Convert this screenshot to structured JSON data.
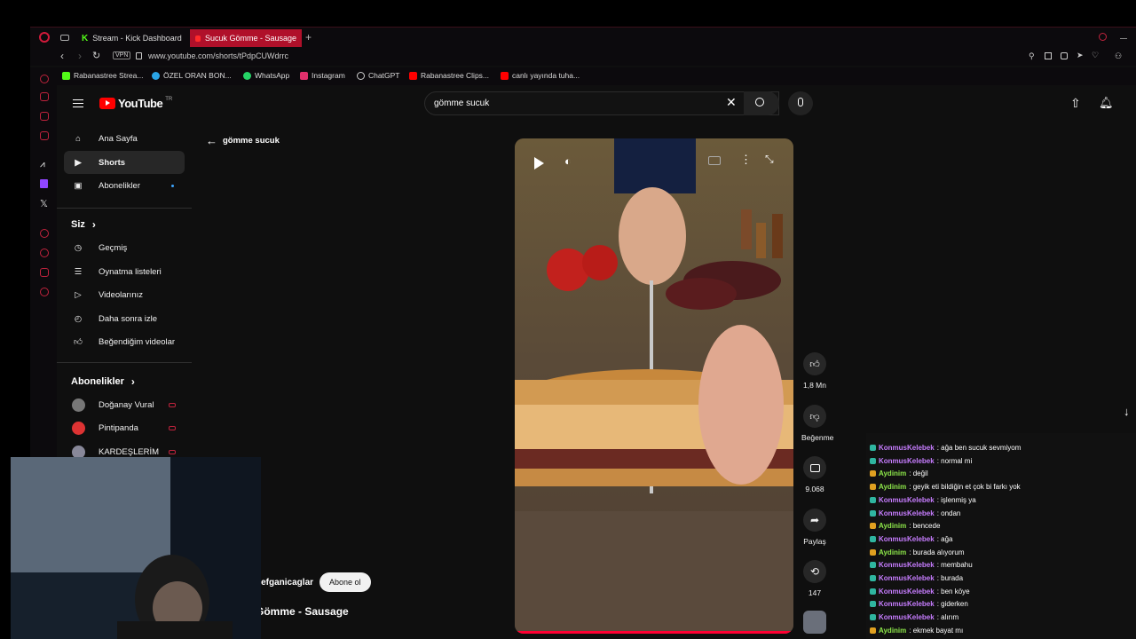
{
  "browser": {
    "tabs": [
      {
        "label": "Stream - Kick Dashboard",
        "active": false
      },
      {
        "label": "Sucuk Gömme - Sausage",
        "active": true
      }
    ],
    "url": "www.youtube.com/shorts/tPdpCUWdrrc",
    "vpn_label": "VPN",
    "bookmarks": [
      "Rabanastree Strea...",
      "ÖZEL ORAN BON...",
      "WhatsApp",
      "Instagram",
      "ChatGPT",
      "Rabanastree Clips...",
      "canlı yayında tuha..."
    ]
  },
  "youtube": {
    "logo": "YouTube",
    "region": "TR",
    "search_value": "gömme sucuk",
    "back_label": "gömme sucuk",
    "nav": {
      "home": "Ana Sayfa",
      "shorts": "Shorts",
      "subscriptions": "Abonelikler",
      "you_section": "Siz",
      "history": "Geçmiş",
      "playlists": "Oynatma listeleri",
      "your_videos": "Videolarınız",
      "watch_later": "Daha sonra izle",
      "liked": "Beğendiğim videolar",
      "subs_section": "Abonelikler",
      "channels": [
        "Doğanay Vural",
        "Pintipanda",
        "KARDEŞLERİM"
      ]
    },
    "short": {
      "channel": "hefganicaglar",
      "subscribe": "Abone ol",
      "title": "Gömme - Sausage",
      "likes": "1,8 Mn",
      "dislike": "Beğenme",
      "comments": "9.068",
      "share": "Paylaş",
      "remix": "147"
    }
  },
  "chat": [
    {
      "user": "KonmusKelebek",
      "text": ": ağa ben sucuk sevmiyom",
      "color": "#c77dff"
    },
    {
      "user": "KonmusKelebek",
      "text": ": normal mi",
      "color": "#c77dff"
    },
    {
      "user": "Aydinim",
      "text": ": değil",
      "color": "#8ee84a"
    },
    {
      "user": "Aydinim",
      "text": ": geyik eti bildiğin et çok bi farkı yok",
      "color": "#8ee84a"
    },
    {
      "user": "KonmusKelebek",
      "text": ": işlenmiş ya",
      "color": "#c77dff"
    },
    {
      "user": "KonmusKelebek",
      "text": ": ondan",
      "color": "#c77dff"
    },
    {
      "user": "Aydinim",
      "text": ": bencede",
      "color": "#8ee84a"
    },
    {
      "user": "KonmusKelebek",
      "text": ": ağa",
      "color": "#c77dff"
    },
    {
      "user": "Aydinim",
      "text": ": burada alıyorum",
      "color": "#8ee84a"
    },
    {
      "user": "KonmusKelebek",
      "text": ": membahu",
      "color": "#c77dff"
    },
    {
      "user": "KonmusKelebek",
      "text": ": burada",
      "color": "#c77dff"
    },
    {
      "user": "KonmusKelebek",
      "text": ": ben köye",
      "color": "#c77dff"
    },
    {
      "user": "KonmusKelebek",
      "text": ": giderken",
      "color": "#c77dff"
    },
    {
      "user": "KonmusKelebek",
      "text": ": alırım",
      "color": "#c77dff"
    },
    {
      "user": "Aydinim",
      "text": ": ekmek bayat mı",
      "color": "#8ee84a"
    }
  ]
}
